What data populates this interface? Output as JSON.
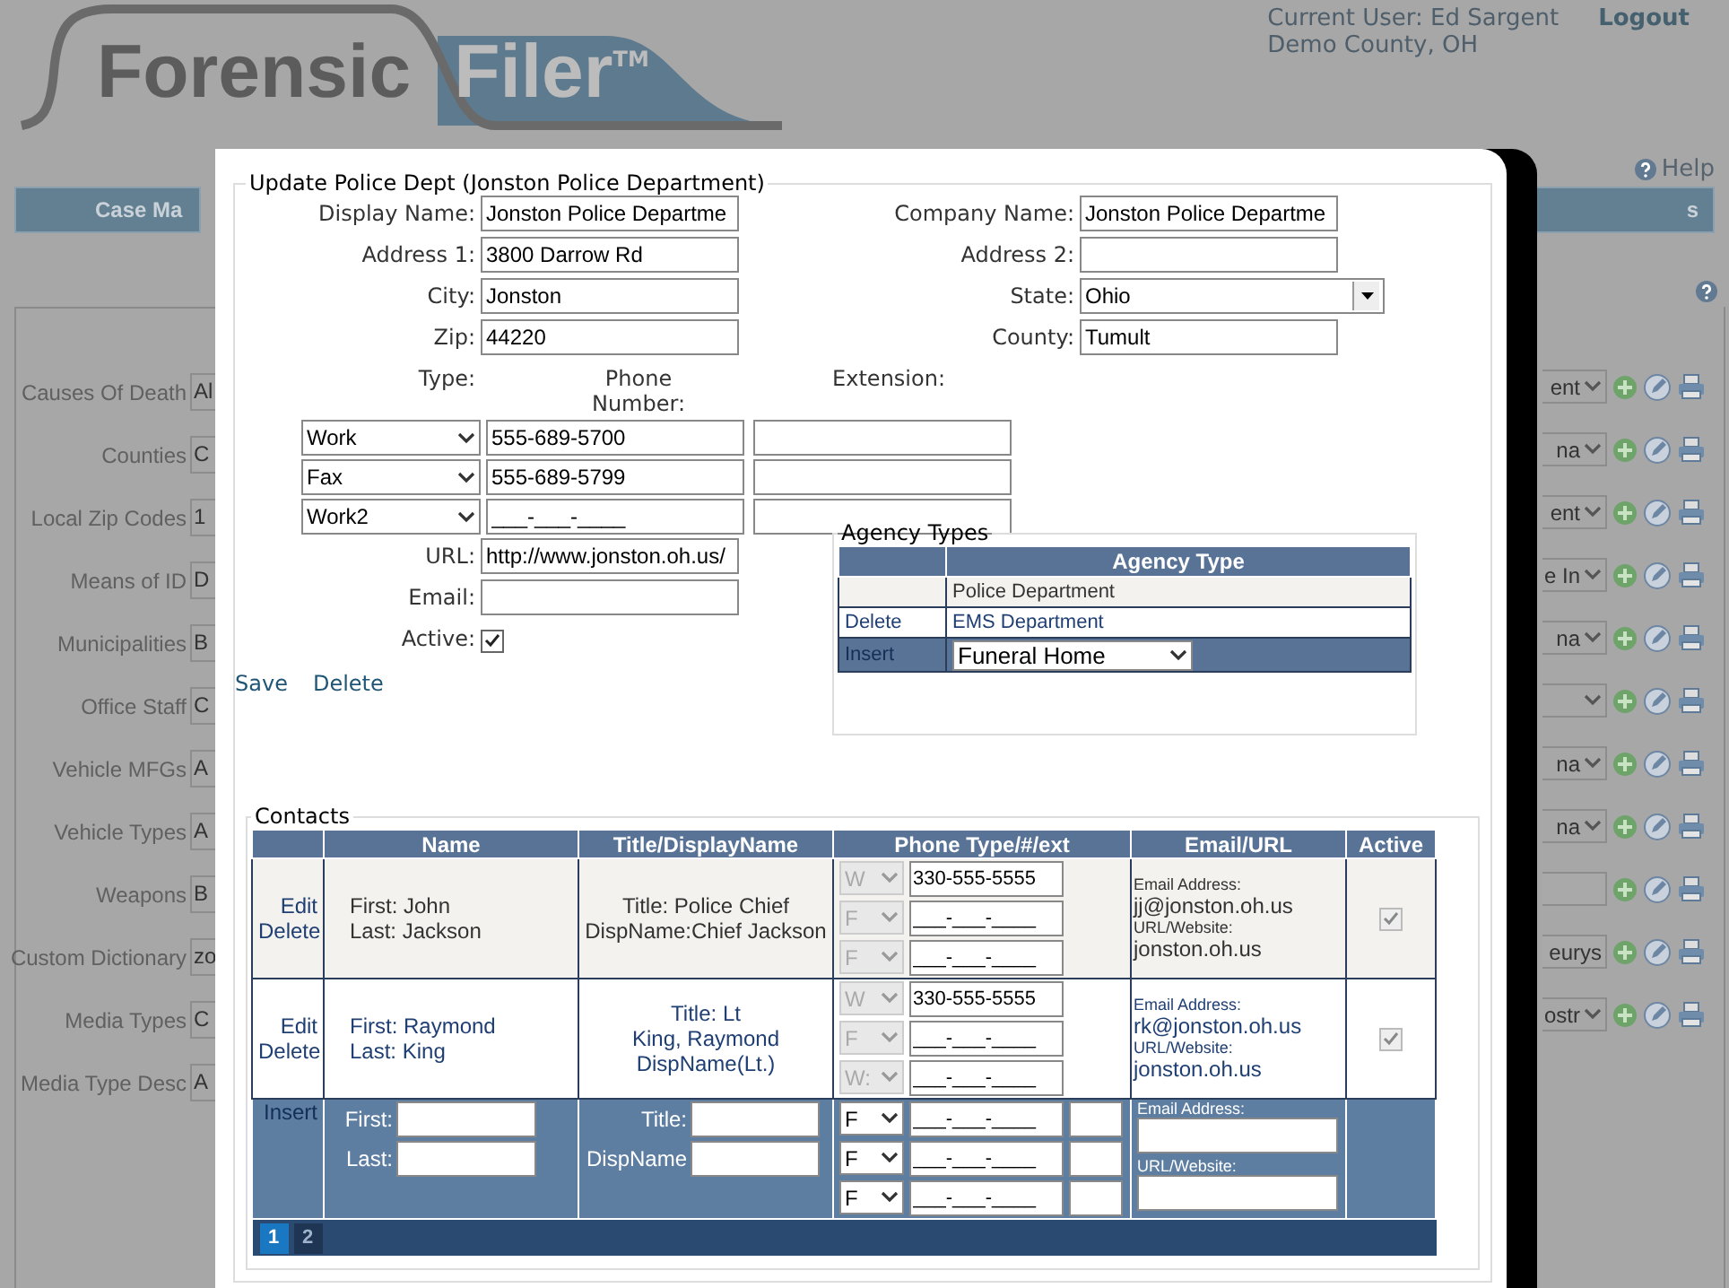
{
  "header": {
    "logo": {
      "word_1": "Forensic",
      "word_2": "Filer",
      "mark": "TM"
    },
    "user_label": "Current User:",
    "user": "Ed Sargent",
    "logout": "Logout",
    "location": "Demo County, OH"
  },
  "help": "Help",
  "nav": {
    "left": "Case Ma",
    "right": "s"
  },
  "lookups_left": [
    {
      "label": "Causes Of Death",
      "value": "Al"
    },
    {
      "label": "Counties",
      "value": "C"
    },
    {
      "label": "Local Zip Codes",
      "value": "1"
    },
    {
      "label": "Means of ID",
      "value": "D"
    },
    {
      "label": "Municipalities",
      "value": "B"
    },
    {
      "label": "Office Staff",
      "value": "C"
    },
    {
      "label": "Vehicle MFGs",
      "value": "A"
    },
    {
      "label": "Vehicle Types",
      "value": "A"
    },
    {
      "label": "Weapons",
      "value": "B"
    },
    {
      "label": "Custom Dictionary",
      "value": "zo"
    },
    {
      "label": "Media Types",
      "value": "C"
    },
    {
      "label": "Media Type Desc",
      "value": "A"
    }
  ],
  "lookups_right": [
    {
      "kind": "select",
      "value": "ent"
    },
    {
      "kind": "select",
      "value": "na"
    },
    {
      "kind": "select",
      "value": "ent"
    },
    {
      "kind": "select",
      "value": "e In"
    },
    {
      "kind": "select",
      "value": "na"
    },
    {
      "kind": "select"
    },
    {
      "kind": "select",
      "value": "na"
    },
    {
      "kind": "select",
      "value": "na"
    },
    {
      "kind": "input"
    },
    {
      "kind": "input",
      "value": "eurys"
    },
    {
      "kind": "select",
      "value": "ostr"
    }
  ],
  "dialog": {
    "title": "Update Police Dept (Jonston Police Department)",
    "fields": [
      {
        "label": "Display Name:",
        "value": "Jonston Police Departme",
        "kind": "input"
      },
      {
        "label": "Company Name:",
        "value": "Jonston Police Departme",
        "kind": "input"
      },
      {
        "label": "Address 1:",
        "value": "3800 Darrow Rd",
        "kind": "input"
      },
      {
        "label": "Address 2:",
        "kind": "input"
      },
      {
        "label": "City:",
        "value": "Jonston",
        "kind": "input"
      },
      {
        "label": "State:",
        "value": "Ohio",
        "kind": "select"
      },
      {
        "label": "Zip:",
        "value": "44220",
        "kind": "input"
      },
      {
        "label": "County:",
        "value": "Tumult",
        "kind": "input"
      }
    ],
    "phone_headers": {
      "type": "Type:",
      "number": "Phone Number:",
      "extension": "Extension:"
    },
    "phones": [
      {
        "type": "Work",
        "number": "555-689-5700"
      },
      {
        "type": "Fax",
        "number": "555-689-5799"
      },
      {
        "type": "Work2",
        "number": "___-___-____"
      }
    ],
    "url": {
      "label": "URL:",
      "value": "http://www.jonston.oh.us/"
    },
    "email": {
      "label": "Email:"
    },
    "active": {
      "label": "Active:",
      "checked": true
    },
    "actions": [
      "Save",
      "Delete"
    ],
    "agency_types": {
      "title": "Agency Types",
      "column": "Agency Type",
      "rows": [
        {
          "name": "Police Department"
        },
        {
          "action": "Delete",
          "name": "EMS Department"
        }
      ],
      "insert": {
        "action": "Insert",
        "value": "Funeral Home"
      }
    },
    "contacts": {
      "title": "Contacts",
      "columns": [
        "Name",
        "Title/DisplayName",
        "Phone Type/#/ext",
        "Email/URL",
        "Active"
      ],
      "rows": [
        {
          "actions": [
            "Edit",
            "Delete"
          ],
          "name_lines": [
            "First: John",
            "Last: Jackson"
          ],
          "title_lines": [
            "Title: Police Chief",
            "DispName:Chief Jackson"
          ],
          "phones": [
            {
              "type": "W",
              "number": "330-555-5555"
            },
            {
              "type": "F",
              "number": "___-___-____"
            },
            {
              "type": "F",
              "number": "___-___-____"
            }
          ],
          "email_label": "Email Address:",
          "email": "jj@jonston.oh.us",
          "url_label": "URL/Website:",
          "url": "jonston.oh.us",
          "active": true
        },
        {
          "actions": [
            "Edit",
            "Delete"
          ],
          "name_lines": [
            "First: Raymond",
            "Last: King"
          ],
          "title_lines": [
            "Title: Lt",
            "King, Raymond",
            "DispName(Lt.)"
          ],
          "phones": [
            {
              "type": "W",
              "number": "330-555-5555"
            },
            {
              "type": "F",
              "number": "___-___-____"
            },
            {
              "type": "W:",
              "number": "___-___-____"
            }
          ],
          "email_label": "Email Address:",
          "email": "rk@jonston.oh.us",
          "url_label": "URL/Website:",
          "url": "jonston.oh.us",
          "active": true
        }
      ],
      "insert": {
        "action": "Insert",
        "first_label": "First:",
        "last_label": "Last:",
        "title_label": "Title:",
        "disp_label": "DispName",
        "phones": [
          {
            "type": "F",
            "number": "___-___-____"
          },
          {
            "type": "F",
            "number": "___-___-____"
          },
          {
            "type": "F",
            "number": "___-___-____"
          }
        ],
        "email_label": "Email Address:",
        "url_label": "URL/Website:"
      },
      "pages": [
        {
          "label": "1",
          "selected": true
        },
        {
          "label": "2",
          "selected": false
        }
      ]
    }
  }
}
